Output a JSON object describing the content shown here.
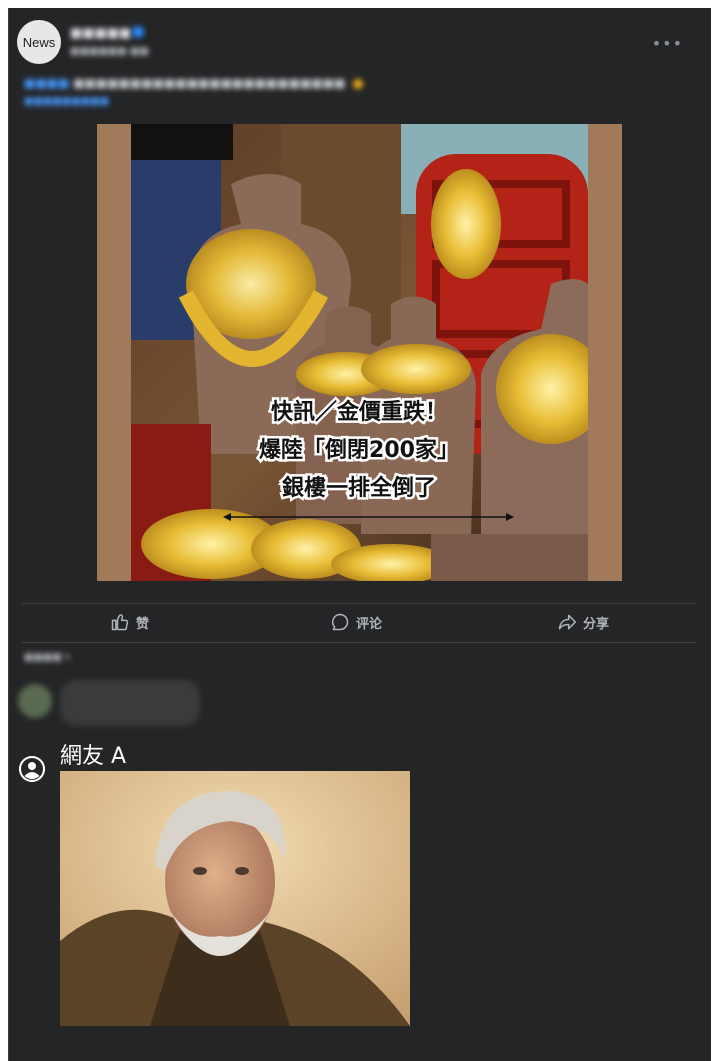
{
  "post": {
    "avatar_text": "News",
    "page_name": "■■■■■",
    "meta": "■■■■■■ ■■",
    "caption_tag": "■■■■",
    "caption_text": "■■■■■■■■■■■■■■■■■■■■■■■■",
    "caption_link": "■■■■■■■■■"
  },
  "image_text": {
    "line1": "快訊／金價重跌！",
    "line2": "爆陸「倒閉200家」",
    "line3": "銀樓一排全倒了"
  },
  "actions": {
    "like": "赞",
    "comment": "评论",
    "share": "分享"
  },
  "comments": {
    "sort_label": "■■■■ ▾",
    "blurred_name": "■■■■",
    "blurred_text": "■■■■■■■■",
    "commenter_name": "網友 A"
  },
  "colors": {
    "background": "#242526",
    "text_secondary": "#b0b3b8",
    "link": "#4599ff"
  }
}
